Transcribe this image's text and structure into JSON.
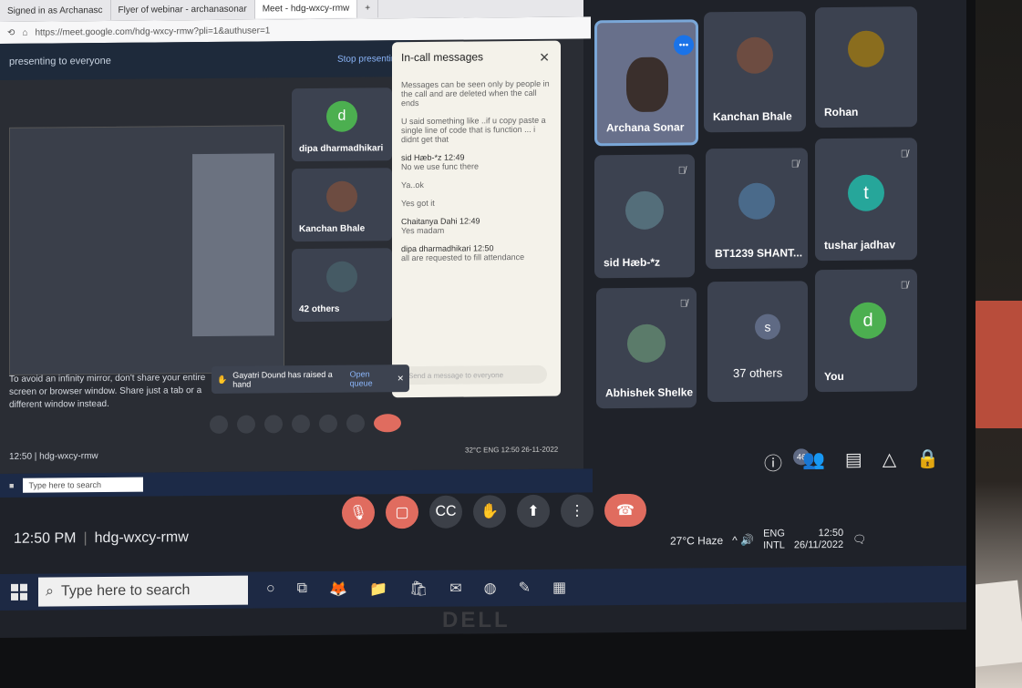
{
  "browser": {
    "tabs": [
      {
        "label": "Signed in as Archanasc",
        "active": false
      },
      {
        "label": "Flyer of webinar - archanasonar",
        "active": false
      },
      {
        "label": "Meet - hdg-wxcy-rmw",
        "active": true
      }
    ],
    "url": "https://meet.google.com/hdg-wxcy-rmw?pli=1&authuser=1"
  },
  "shared_screen": {
    "presenting_text": "presenting to everyone",
    "stop_label": "Stop presenting",
    "warning": "To avoid an infinity mirror, don't share your entire screen or browser window. Share just a tab or a different window instead.",
    "mini_tiles": [
      {
        "name": "dipa dharmadhikari",
        "avatar_letter": "d",
        "avatar_color": "#4caf50"
      },
      {
        "name": "Kanchan Bhale",
        "avatar_letter": "",
        "avatar_color": "#6d4c41"
      },
      {
        "name": "42 others",
        "avatar_letter": "",
        "avatar_color": "#455a64"
      }
    ],
    "chat": {
      "title": "In-call messages",
      "notice": "Messages can be seen only by people in the call and are deleted when the call ends",
      "messages": [
        {
          "sender": "",
          "text": "U said something like ..if u copy paste a single line of code that is function ... i didnt get that"
        },
        {
          "sender": "sid Hæb-*z 12:49",
          "text": "No we use func there"
        },
        {
          "sender": "",
          "text": "Ya..ok"
        },
        {
          "sender": "",
          "text": "Yes got it"
        },
        {
          "sender": "Chaitanya Dahi 12:49",
          "text": "Yes madam"
        },
        {
          "sender": "dipa dharmadhikari 12:50",
          "text": "all are requested to fill attendance"
        }
      ],
      "input_placeholder": "Send a message to everyone"
    },
    "hand_banner": {
      "text": "Gayatri Dound has raised a hand",
      "action": "Open queue"
    },
    "meet_info": "12:50 | hdg-wxcy-rmw",
    "taskbar_search": "Type here to search",
    "tray": "32°C ENG 12:50 26-11-2022"
  },
  "participants": [
    {
      "name": "Archana Sonar",
      "active": true,
      "muted": false,
      "avatar": "photo",
      "color": "#68708b"
    },
    {
      "name": "Kanchan Bhale",
      "active": false,
      "muted": false,
      "avatar": "photo",
      "color": "#6d4c41"
    },
    {
      "name": "Rohan",
      "active": false,
      "muted": false,
      "avatar": "photo",
      "color": "#8a6d1e"
    },
    {
      "name": "sid Hæb-*z",
      "active": false,
      "muted": true,
      "avatar": "photo",
      "color": "#546e7a"
    },
    {
      "name": "BT1239 SHANT...",
      "active": false,
      "muted": true,
      "avatar": "photo",
      "color": "#4a6a8a"
    },
    {
      "name": "tushar jadhav",
      "active": false,
      "muted": true,
      "avatar": "t",
      "color": "#26a69a"
    },
    {
      "name": "Abhishek Shelke",
      "active": false,
      "muted": true,
      "avatar": "photo",
      "color": "#5b7b6a"
    },
    {
      "name": "37 others",
      "active": false,
      "muted": false,
      "avatar": "s",
      "color": "#5f6a84"
    },
    {
      "name": "You",
      "active": false,
      "muted": true,
      "avatar": "d",
      "color": "#4caf50"
    }
  ],
  "right_toolbar": {
    "participants_count": "46"
  },
  "meeting": {
    "time": "12:50 PM",
    "code": "hdg-wxcy-rmw"
  },
  "taskbar": {
    "search_placeholder": "Type here to search",
    "weather": "27°C Haze",
    "lang1": "ENG",
    "lang2": "INTL",
    "time": "12:50",
    "date": "26/11/2022"
  },
  "brand": "DELL"
}
